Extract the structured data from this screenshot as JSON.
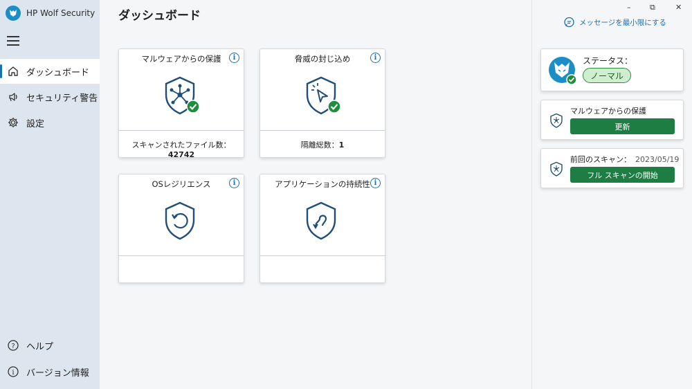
{
  "app": {
    "title": "HP Wolf Security"
  },
  "sidebar": {
    "items": [
      {
        "label": "ダッシュボード",
        "icon": "home-icon",
        "active": true
      },
      {
        "label": "セキュリティ警告",
        "icon": "alert-speaker-icon"
      },
      {
        "label": "設定",
        "icon": "gear-icon"
      }
    ],
    "bottom_items": [
      {
        "label": "ヘルプ",
        "icon": "help-icon"
      },
      {
        "label": "バージョン情報",
        "icon": "info-icon"
      }
    ]
  },
  "main": {
    "title": "ダッシュボード",
    "cards": [
      {
        "title": "マルウェアからの保護",
        "footer_label": "スキャンされたファイル数：",
        "footer_value": "42742",
        "icon": "network-shield-icon",
        "checked": true
      },
      {
        "title": "脅威の封じ込め",
        "footer_label": "隔離総数：",
        "footer_value": "1",
        "icon": "cursor-shield-icon",
        "checked": true
      },
      {
        "title": "OSレジリエンス",
        "footer_label": "",
        "footer_value": "",
        "icon": "restore-shield-icon",
        "checked": false
      },
      {
        "title": "アプリケーションの持続性",
        "footer_label": "",
        "footer_value": "",
        "icon": "loop-shield-icon",
        "checked": false
      }
    ],
    "info_glyph": "i"
  },
  "right_panel": {
    "minimize_messages": "メッセージを最小限にする",
    "status": {
      "label": "ステータス：",
      "value": "ノーマル"
    },
    "malware": {
      "title": "マルウェアからの保護",
      "button": "更新"
    },
    "scan": {
      "title": "前回のスキャン：",
      "date": "2023/05/19",
      "button": "フル スキャンの開始"
    }
  },
  "window_controls": {
    "minimize": "–",
    "restore": "⧉",
    "close": "✕"
  },
  "colors": {
    "accent": "#1a6fb5",
    "shield": "#1f4e79",
    "check": "#1e8e3e",
    "button_green": "#1e7d42",
    "sidebar_bg": "#dde6ee"
  }
}
